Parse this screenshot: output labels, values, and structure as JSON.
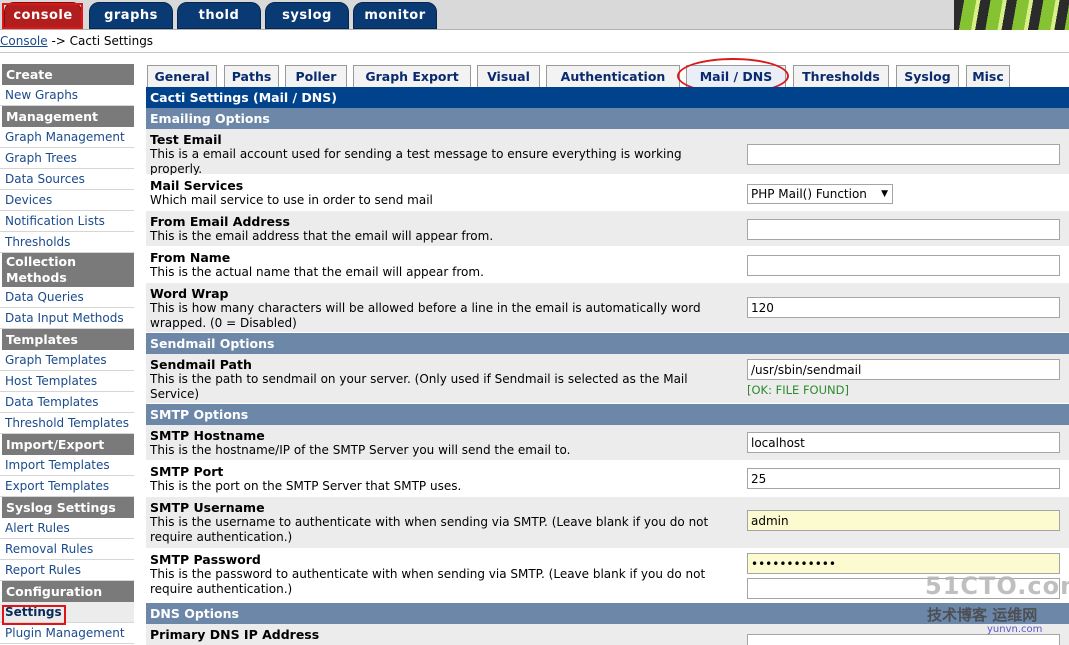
{
  "top_tabs": [
    {
      "label": "console",
      "active": true
    },
    {
      "label": "graphs",
      "active": false
    },
    {
      "label": "thold",
      "active": false
    },
    {
      "label": "syslog",
      "active": false
    },
    {
      "label": "monitor",
      "active": false
    }
  ],
  "breadcrumb": {
    "link": "Console",
    "separator": " -> ",
    "current": "Cacti Settings"
  },
  "sidebar": {
    "sections": [
      {
        "header": "Create",
        "items": [
          "New Graphs"
        ]
      },
      {
        "header": "Management",
        "items": [
          "Graph Management",
          "Graph Trees",
          "Data Sources",
          "Devices",
          "Notification Lists",
          "Thresholds"
        ]
      },
      {
        "header": "Collection Methods",
        "items": [
          "Data Queries",
          "Data Input Methods"
        ]
      },
      {
        "header": "Templates",
        "items": [
          "Graph Templates",
          "Host Templates",
          "Data Templates",
          "Threshold Templates"
        ]
      },
      {
        "header": "Import/Export",
        "items": [
          "Import Templates",
          "Export Templates"
        ]
      },
      {
        "header": "Syslog Settings",
        "items": [
          "Alert Rules",
          "Removal Rules",
          "Report Rules"
        ]
      },
      {
        "header": "Configuration",
        "items": [
          "Settings",
          "Plugin Management"
        ]
      }
    ],
    "selected_item": "Settings"
  },
  "settings_tabs": [
    "General",
    "Paths",
    "Poller",
    "Graph Export",
    "Visual",
    "Authentication",
    "Mail / DNS",
    "Thresholds",
    "Syslog",
    "Misc"
  ],
  "active_settings_tab": "Mail / DNS",
  "panel": {
    "title": "Cacti Settings (Mail / DNS)",
    "sections": [
      {
        "header": "Emailing Options",
        "rows": [
          {
            "name": "Test Email",
            "desc": "This is a email account used for sending a test message to ensure everything is working properly.",
            "type": "text",
            "value": ""
          },
          {
            "name": "Mail Services",
            "desc": "Which mail service to use in order to send mail",
            "type": "select",
            "value": "PHP Mail() Function"
          },
          {
            "name": "From Email Address",
            "desc": "This is the email address that the email will appear from.",
            "type": "text",
            "value": ""
          },
          {
            "name": "From Name",
            "desc": "This is the actual name that the email will appear from.",
            "type": "text",
            "value": ""
          },
          {
            "name": "Word Wrap",
            "desc": "This is how many characters will be allowed before a line in the email is automatically word wrapped. (0 = Disabled)",
            "type": "text",
            "value": "120"
          }
        ]
      },
      {
        "header": "Sendmail Options",
        "rows": [
          {
            "name": "Sendmail Path",
            "desc": "This is the path to sendmail on your server. (Only used if Sendmail is selected as the Mail Service)",
            "type": "text",
            "value": "/usr/sbin/sendmail",
            "status": "[OK: FILE FOUND]"
          }
        ]
      },
      {
        "header": "SMTP Options",
        "rows": [
          {
            "name": "SMTP Hostname",
            "desc": "This is the hostname/IP of the SMTP Server you will send the email to.",
            "type": "text",
            "value": "localhost"
          },
          {
            "name": "SMTP Port",
            "desc": "This is the port on the SMTP Server that SMTP uses.",
            "type": "text",
            "value": "25"
          },
          {
            "name": "SMTP Username",
            "desc": "This is the username to authenticate with when sending via SMTP. (Leave blank if you do not require authentication.)",
            "type": "text",
            "value": "admin",
            "highlight": true
          },
          {
            "name": "SMTP Password",
            "desc": "This is the password to authenticate with when sending via SMTP. (Leave blank if you do not require authentication.)",
            "type": "password",
            "value": "••••••••••••",
            "highlight": true
          }
        ]
      },
      {
        "header": "DNS Options",
        "rows": [
          {
            "name": "Primary DNS IP Address",
            "desc": "",
            "type": "text",
            "value": ""
          }
        ]
      }
    ]
  },
  "watermark": {
    "big": "51CTO.com",
    "sub": "技术博客",
    "right": "运维网",
    "small": "yunvn.com"
  },
  "colors": {
    "title_bar": "#00438c",
    "section_bar": "#6d87a8",
    "top_tab": "#0a3a73",
    "active_top_tab": "#b21e1e",
    "link": "#1a4b8c",
    "status_ok": "#2d8a2d",
    "highlight_field": "#fbfbcf"
  }
}
